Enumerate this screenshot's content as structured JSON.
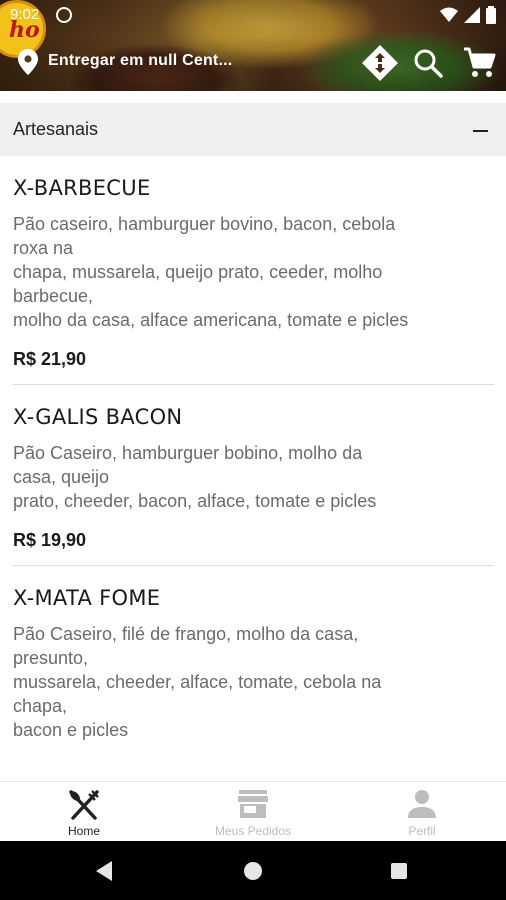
{
  "status_bar": {
    "time": "9:02"
  },
  "header": {
    "logo_text": "ho",
    "delivery_label": "Entregar em null Cent..."
  },
  "category": {
    "title": "Artesanais"
  },
  "products": [
    {
      "name": "X-BARBECUE",
      "description_lines": [
        "Pão caseiro, hamburguer bovino, bacon, cebola",
        "roxa na",
        "chapa, mussarela, queijo prato, ceeder, molho",
        "barbecue,",
        "molho da casa, alface americana, tomate e picles"
      ],
      "price": "R$ 21,90"
    },
    {
      "name": "X-GALIS BACON",
      "description_lines": [
        "Pão Caseiro, hamburguer bobino, molho da",
        "casa, queijo",
        "prato, cheeder, bacon, alface, tomate e picles"
      ],
      "price": "R$ 19,90"
    },
    {
      "name": "X-MATA FOME",
      "description_lines": [
        "Pão Caseiro, filé de frango, molho da casa,",
        "presunto,",
        "mussarela, cheeder, alface, tomate, cebola na",
        "chapa,",
        "bacon e picles"
      ],
      "price": ""
    }
  ],
  "bottom_nav": [
    {
      "label": "Home",
      "icon": "utensils-icon",
      "active": true
    },
    {
      "label": "Meus Pedidos",
      "icon": "store-icon",
      "active": false
    },
    {
      "label": "Perfil",
      "icon": "person-icon",
      "active": false
    }
  ],
  "colors": {
    "category_bg": "#efefef",
    "text_primary": "#1a1a1a",
    "text_secondary": "#6b6b6b",
    "nav_inactive": "#bdbdbd",
    "logo_yellow": "#f2c21b",
    "logo_red": "#c1121f"
  }
}
